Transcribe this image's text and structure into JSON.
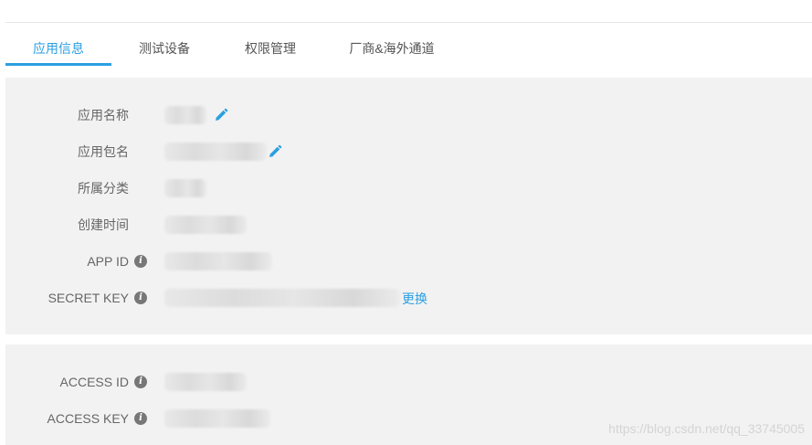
{
  "tabs": [
    {
      "label": "应用信息",
      "active": true
    },
    {
      "label": "测试设备",
      "active": false
    },
    {
      "label": "权限管理",
      "active": false
    },
    {
      "label": "厂商&海外通道",
      "active": false
    }
  ],
  "app_info": {
    "app_name_label": "应用名称",
    "package_name_label": "应用包名",
    "category_label": "所属分类",
    "created_time_label": "创建时间",
    "app_id_label": "APP ID",
    "secret_key_label": "SECRET KEY",
    "replace_link": "更换"
  },
  "access": {
    "access_id_label": "ACCESS ID",
    "access_key_label": "ACCESS KEY"
  },
  "watermark": "https://blog.csdn.net/qq_33745005",
  "icons": {
    "edit": "pencil-icon",
    "info": "info-icon"
  },
  "colors": {
    "accent": "#2a9fe1",
    "panel": "#f2f2f2"
  }
}
